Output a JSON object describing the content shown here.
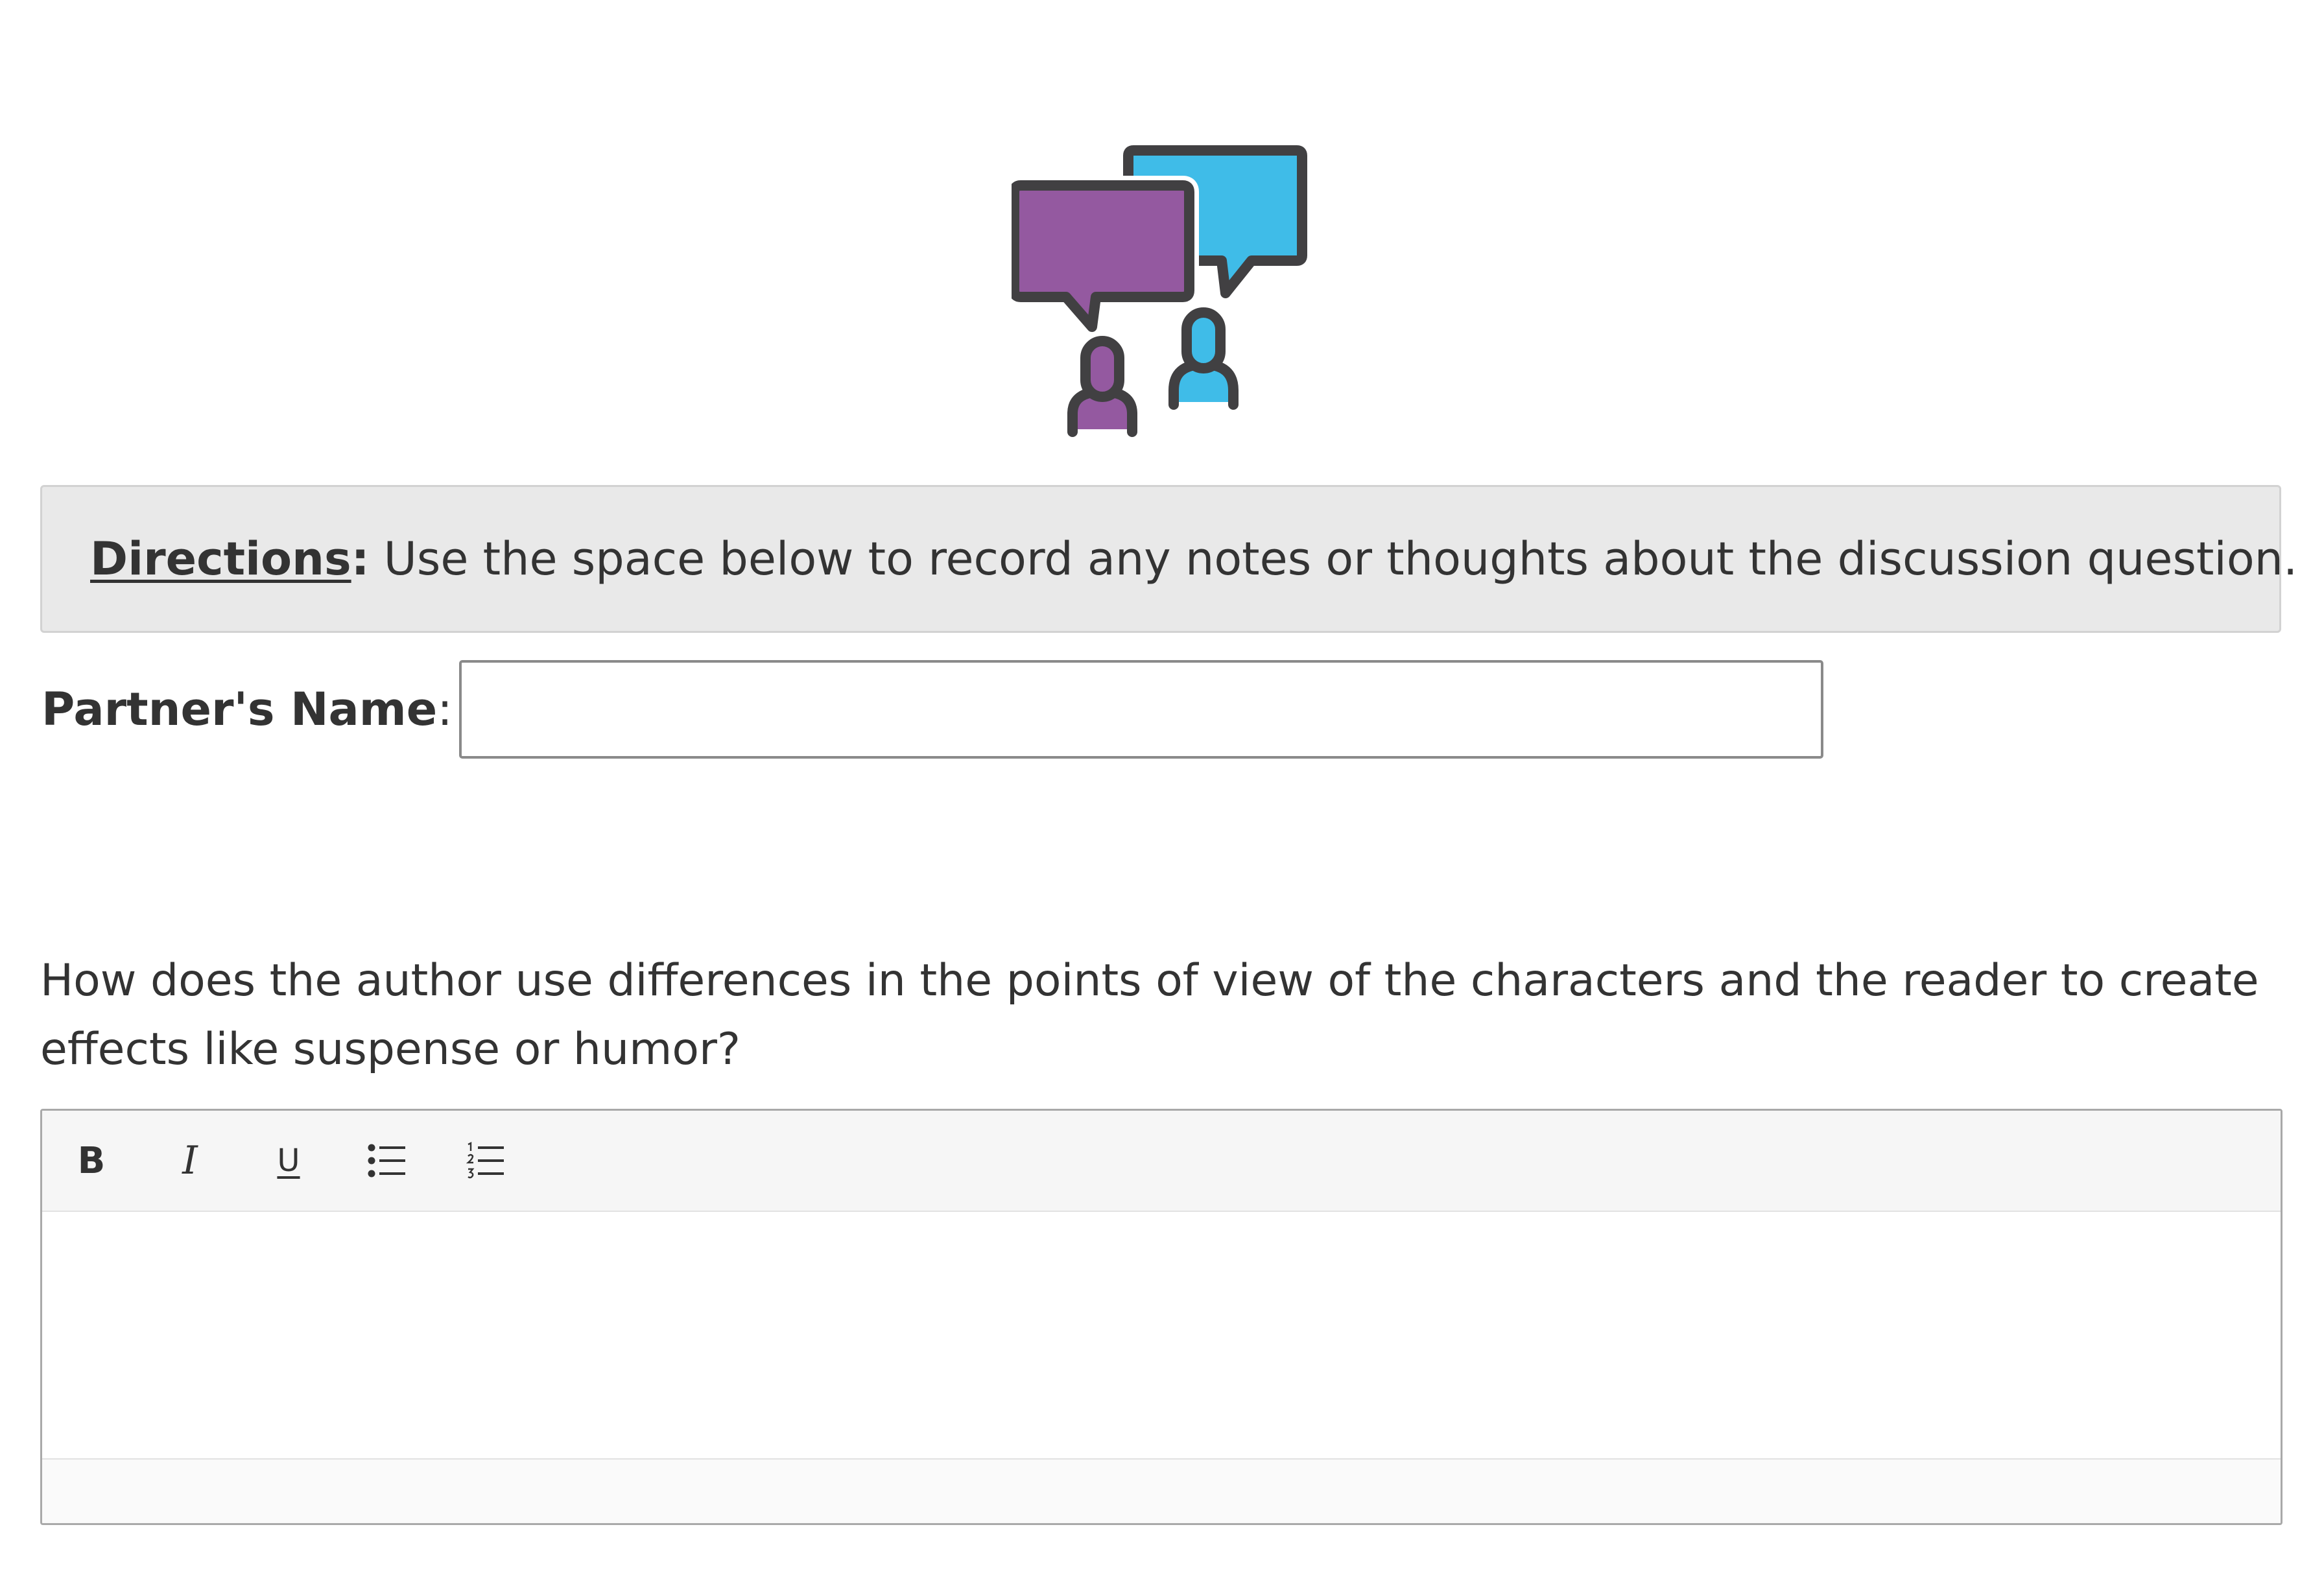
{
  "header": {
    "icon": "discussion-people-speech-bubbles-icon",
    "colors": {
      "purple": "#9459a0",
      "blue": "#3fbce8",
      "outline": "#414042"
    }
  },
  "directions": {
    "label": "Directions",
    "colon": ":",
    "text": "Use the space below to record any notes or thoughts about the discussion question."
  },
  "partner": {
    "label": "Partner's Name",
    "colon": ":",
    "value": "",
    "placeholder": ""
  },
  "question": {
    "text": "How does the author use differences in the points of view of the characters and the reader to create effects like suspense or humor?"
  },
  "editor": {
    "toolbar": {
      "bold_label": "B",
      "italic_label": "I",
      "underline_label": "U",
      "bullet_list_icon": "bulleted-list-icon",
      "numbered_list_icon": "numbered-list-icon"
    },
    "content": ""
  }
}
